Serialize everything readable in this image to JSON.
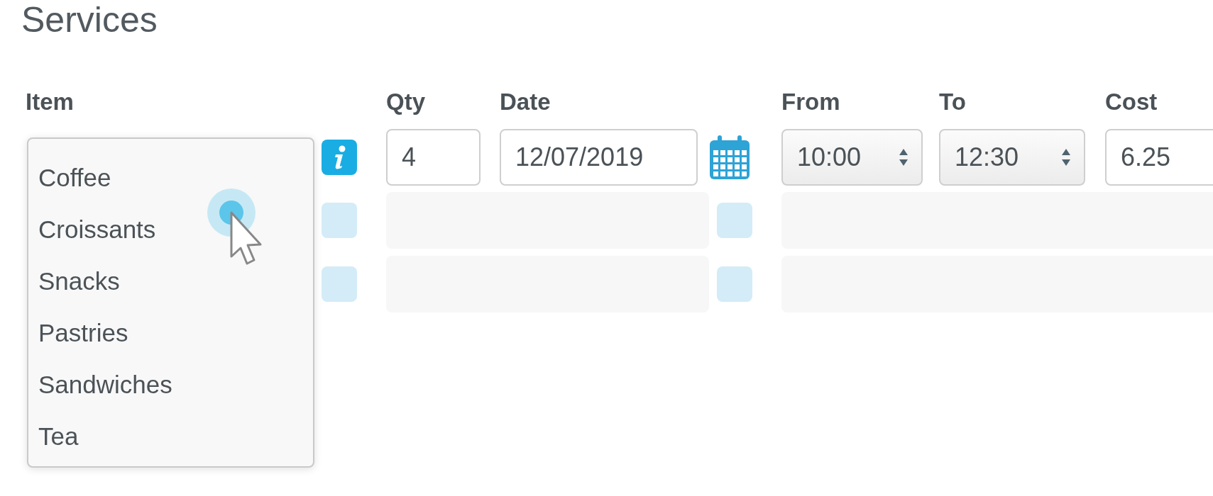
{
  "title": "Services",
  "headers": [
    "Item",
    "Qty",
    "Date",
    "From",
    "To",
    "Cost"
  ],
  "item_dropdown": {
    "options": [
      "Coffee",
      "Croissants",
      "Snacks",
      "Pastries",
      "Sandwiches",
      "Tea"
    ]
  },
  "rows": [
    {
      "kind": "entry",
      "qty": "4",
      "date": "12/07/2019",
      "from": "10:00",
      "to": "12:30",
      "cost": "6.25"
    },
    {
      "kind": "loading"
    },
    {
      "kind": "loading"
    }
  ]
}
